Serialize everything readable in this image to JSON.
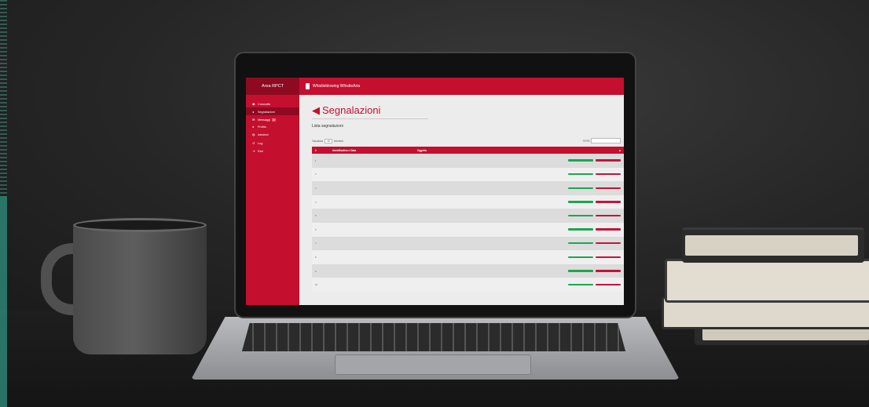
{
  "sidebar": {
    "title": "Area RPCT",
    "items": [
      {
        "label": "Cruscotto",
        "icon": "dashboard-icon"
      },
      {
        "label": "Segnalazioni",
        "icon": "megaphone-icon",
        "active": true
      },
      {
        "label": "Messaggi",
        "icon": "envelope-icon",
        "badge": "2"
      },
      {
        "label": "Profilo",
        "icon": "user-icon"
      },
      {
        "label": "Istruttori",
        "icon": "users-icon"
      },
      {
        "label": "Log",
        "icon": "history-icon"
      },
      {
        "label": "Esci",
        "icon": "logout-icon"
      }
    ]
  },
  "topbar": {
    "title": "Whistleblowing WhistleArta"
  },
  "page": {
    "title": "Segnalazioni",
    "subtitle": "Lista segnalazioni"
  },
  "controls": {
    "show_label": "Visualizza",
    "show_value": "10",
    "show_suffix": "elementi",
    "search_label": "Cerca:"
  },
  "table": {
    "headers": [
      "#",
      "Identificativo e Data",
      "Oggetto"
    ],
    "rows": [
      {
        "n": "1",
        "id_date": "",
        "subject": "",
        "subject2": ""
      },
      {
        "n": "2",
        "id_date": "",
        "subject": "",
        "subject2": ""
      },
      {
        "n": "3",
        "id_date": "",
        "subject": "",
        "subject2": ""
      },
      {
        "n": "4",
        "id_date": "",
        "subject": "",
        "subject2": ""
      },
      {
        "n": "5",
        "id_date": "",
        "subject": "",
        "subject2": ""
      },
      {
        "n": "6",
        "id_date": "",
        "subject": "",
        "subject2": ""
      },
      {
        "n": "7",
        "id_date": "",
        "subject": "",
        "subject2": ""
      },
      {
        "n": "8",
        "id_date": "",
        "subject": "",
        "subject2": ""
      },
      {
        "n": "9",
        "id_date": "",
        "subject": "",
        "subject2": ""
      },
      {
        "n": "10",
        "id_date": "",
        "subject": "",
        "subject2": ""
      }
    ],
    "btn_open": "",
    "btn_delete": ""
  },
  "colors": {
    "brand": "#c40f2f",
    "brand_dark": "#8e0a21",
    "open_button": "#1aa84e",
    "delete_button": "#c2143a"
  }
}
